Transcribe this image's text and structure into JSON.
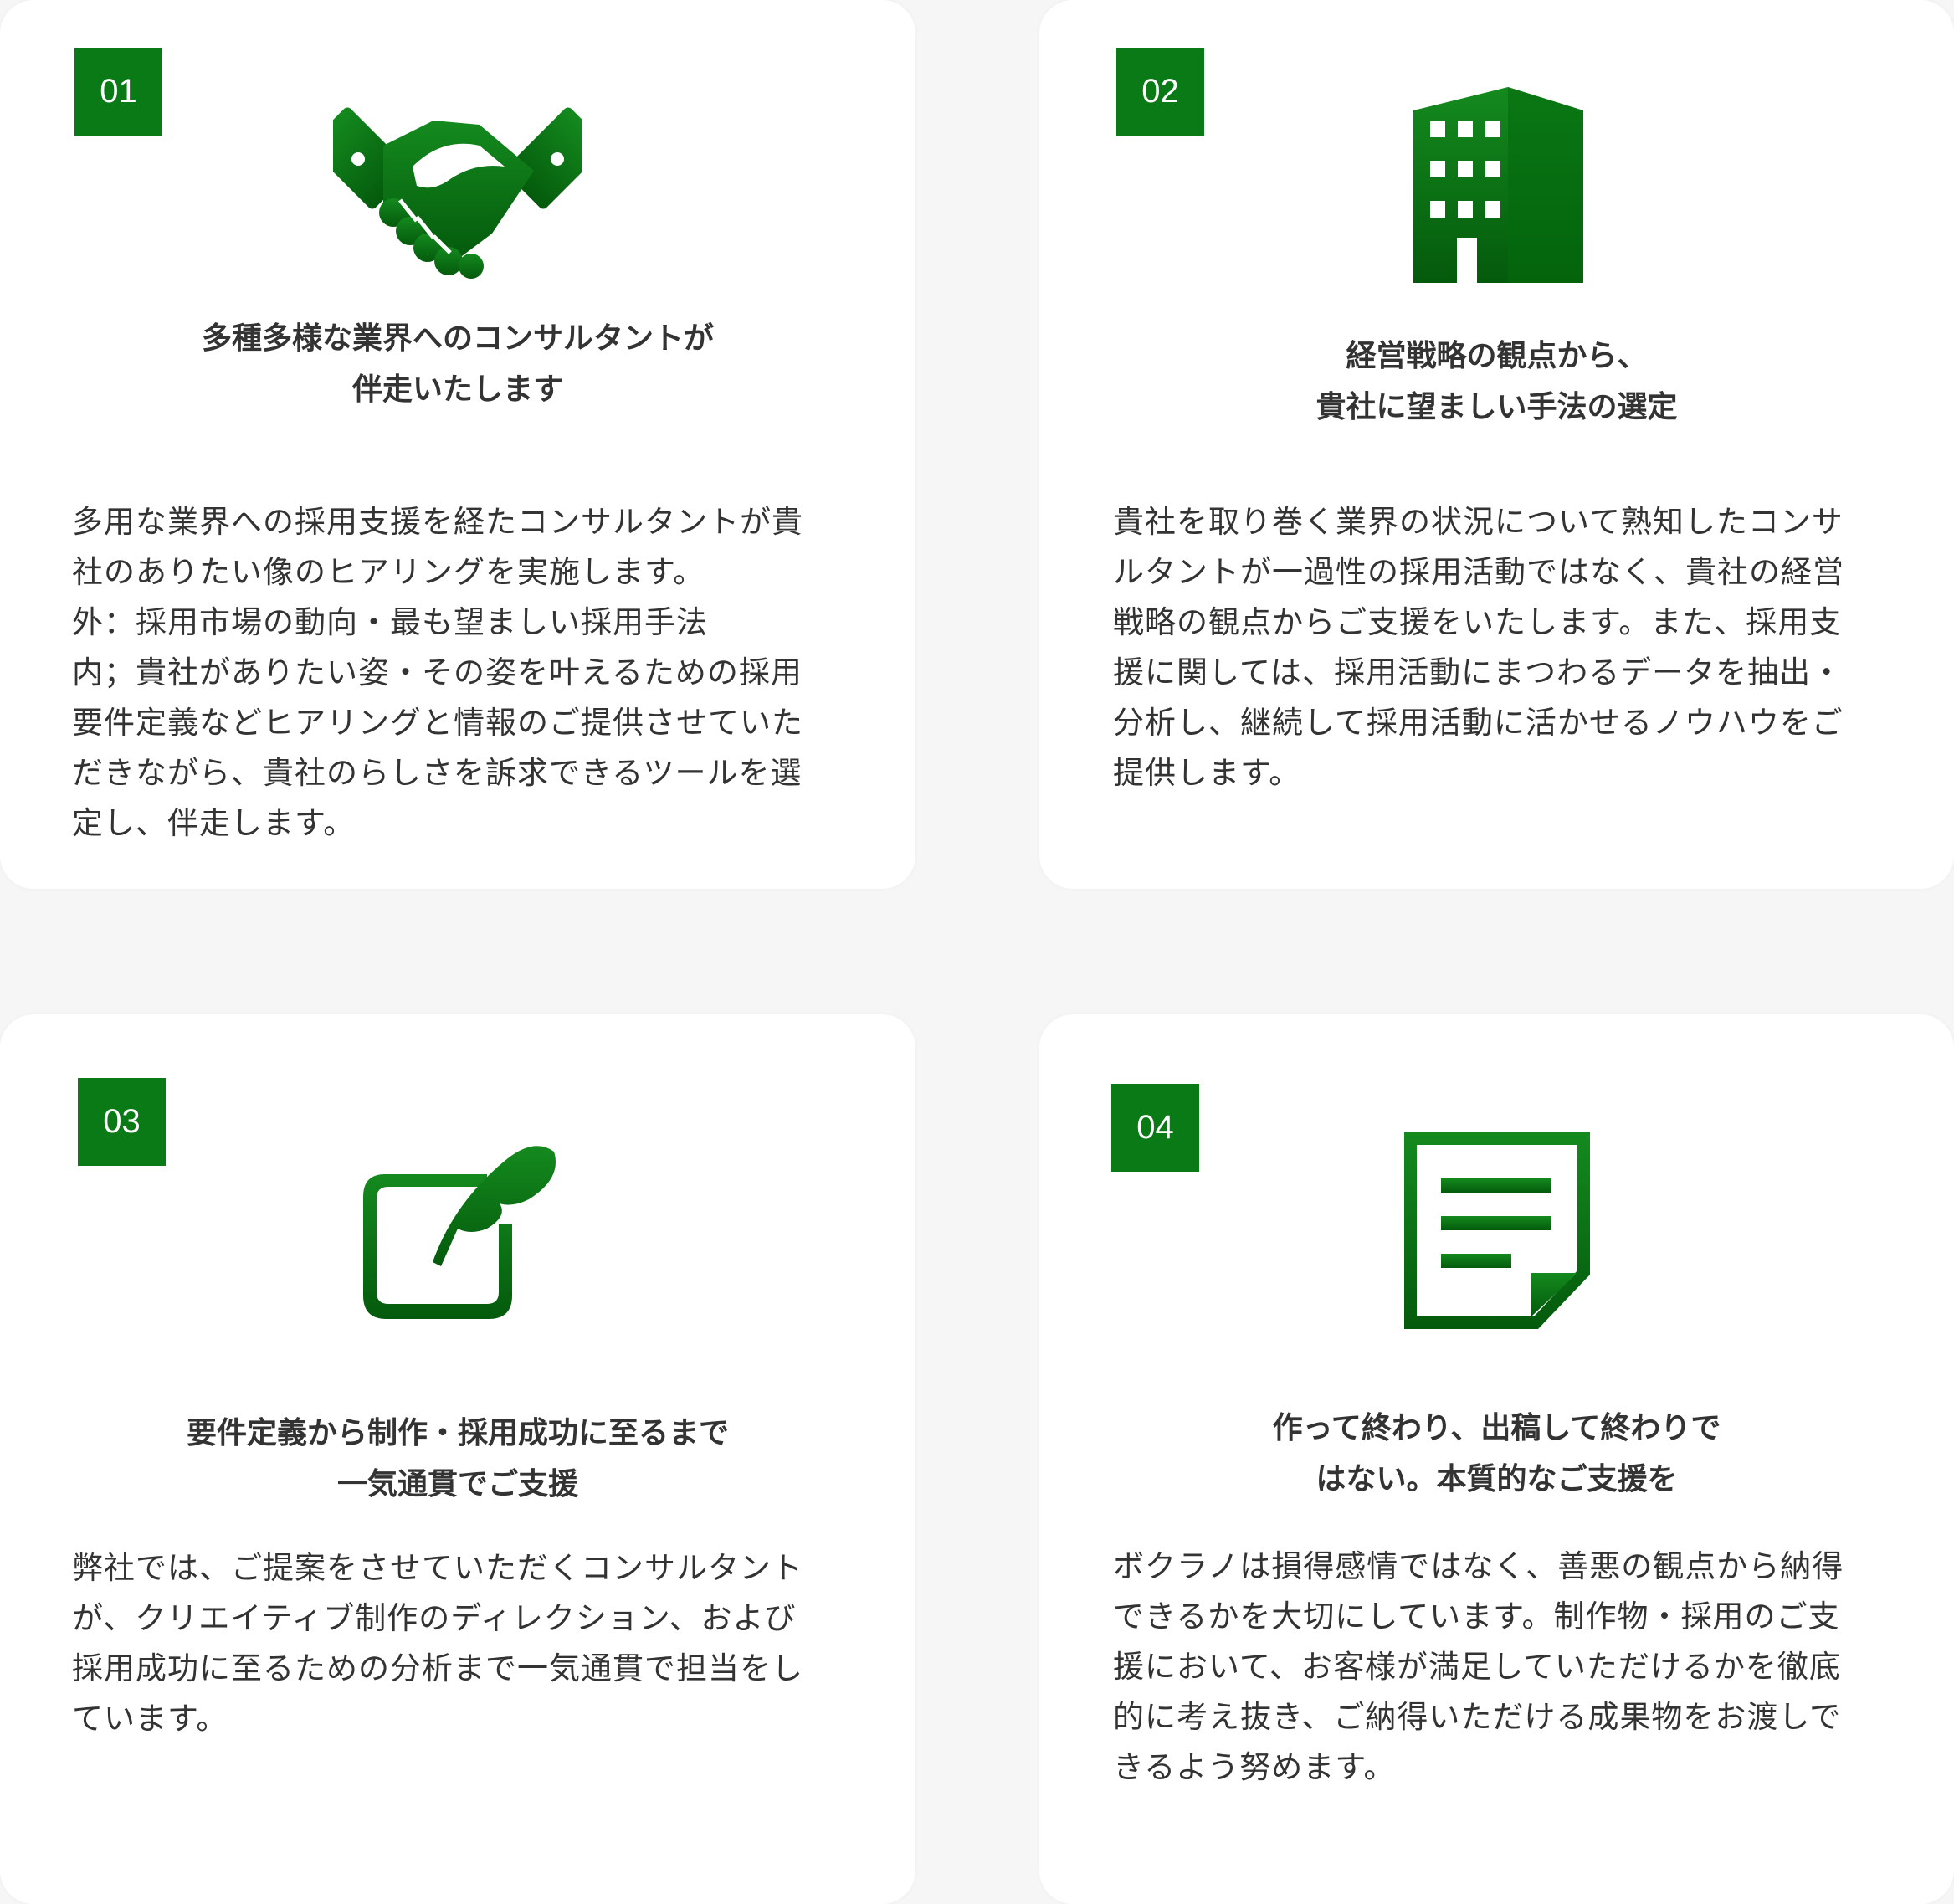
{
  "colors": {
    "accent": "#0a7a16",
    "text": "#333333",
    "background": "#ffffff"
  },
  "cards": [
    {
      "number": "01",
      "icon": "handshake-icon",
      "title": [
        "多種多様な業界へのコンサルタントが",
        "伴走いたします"
      ],
      "body": [
        "多用な業界への採用支援を経たコンサルタントが貴",
        "社のありたい像のヒアリングを実施します。",
        "外：採用市場の動向・最も望ましい採用手法",
        "内；貴社がありたい姿・その姿を叶えるための採用",
        "要件定義などヒアリングと情報のご提供させていた",
        "だきながら、貴社のらしさを訴求できるツールを選",
        "定し、伴走します。"
      ]
    },
    {
      "number": "02",
      "icon": "building-icon",
      "title": [
        "経営戦略の観点から、",
        "貴社に望ましい手法の選定"
      ],
      "body": [
        "貴社を取り巻く業界の状況について熟知したコンサ",
        "ルタントが一過性の採用活動ではなく、貴社の経営",
        "戦略の観点からご支援をいたします。また、採用支",
        "援に関しては、採用活動にまつわるデータを抽出・",
        "分析し、継続して採用活動に活かせるノウハウをご",
        "提供します。"
      ]
    },
    {
      "number": "03",
      "icon": "quill-edit-icon",
      "title": [
        "要件定義から制作・採用成功に至るまで",
        "一気通貫でご支援"
      ],
      "body": [
        "弊社では、ご提案をさせていただくコンサルタント",
        "が、クリエイティブ制作のディレクション、および",
        "採用成功に至るための分析まで一気通貫で担当をし",
        "ています。"
      ]
    },
    {
      "number": "04",
      "icon": "document-icon",
      "title": [
        "作って終わり、出稿して終わりで",
        "はない。本質的なご支援を"
      ],
      "body": [
        "ボクラノは損得感情ではなく、善悪の観点から納得",
        "できるかを大切にしています。制作物・採用のご支",
        "援において、お客様が満足していただけるかを徹底",
        "的に考え抜き、ご納得いただける成果物をお渡しで",
        "きるよう努めます。"
      ]
    }
  ]
}
